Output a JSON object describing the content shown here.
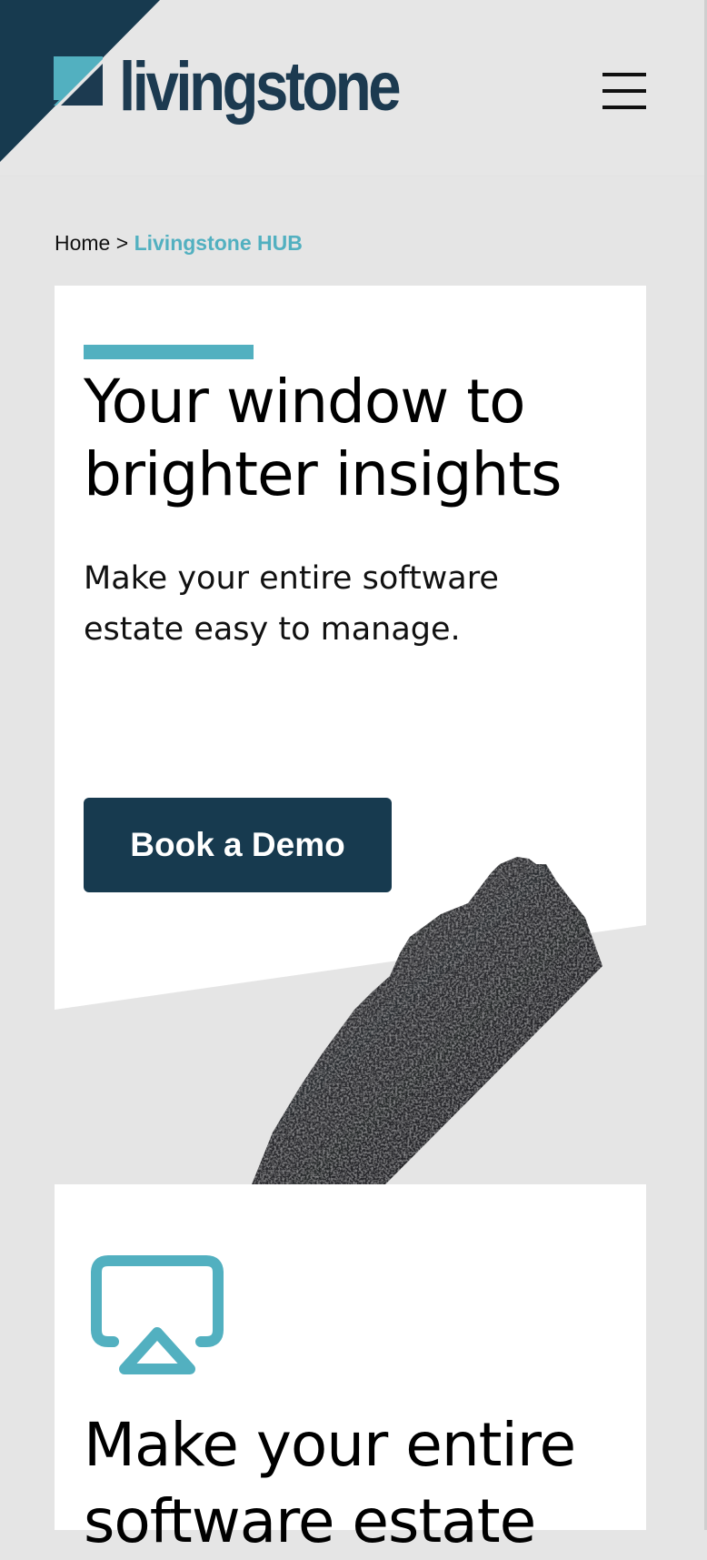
{
  "header": {
    "logo_text": "livingstone",
    "menu_icon": "hamburger-menu-icon",
    "brand_dark": "#173a4f",
    "brand_teal": "#52b0c0"
  },
  "breadcrumb": {
    "home": "Home",
    "separator": ">",
    "current": "Livingstone HUB"
  },
  "hero": {
    "title_line1": "Your window to",
    "title_line2": "brighter insights",
    "subtitle_line1": "Make your entire software",
    "subtitle_line2": "estate easy to manage.",
    "cta_label": "Book a Demo"
  },
  "feature": {
    "icon": "airplay-screen-icon",
    "title_line1": "Make your entire",
    "title_line2": "software estate"
  }
}
